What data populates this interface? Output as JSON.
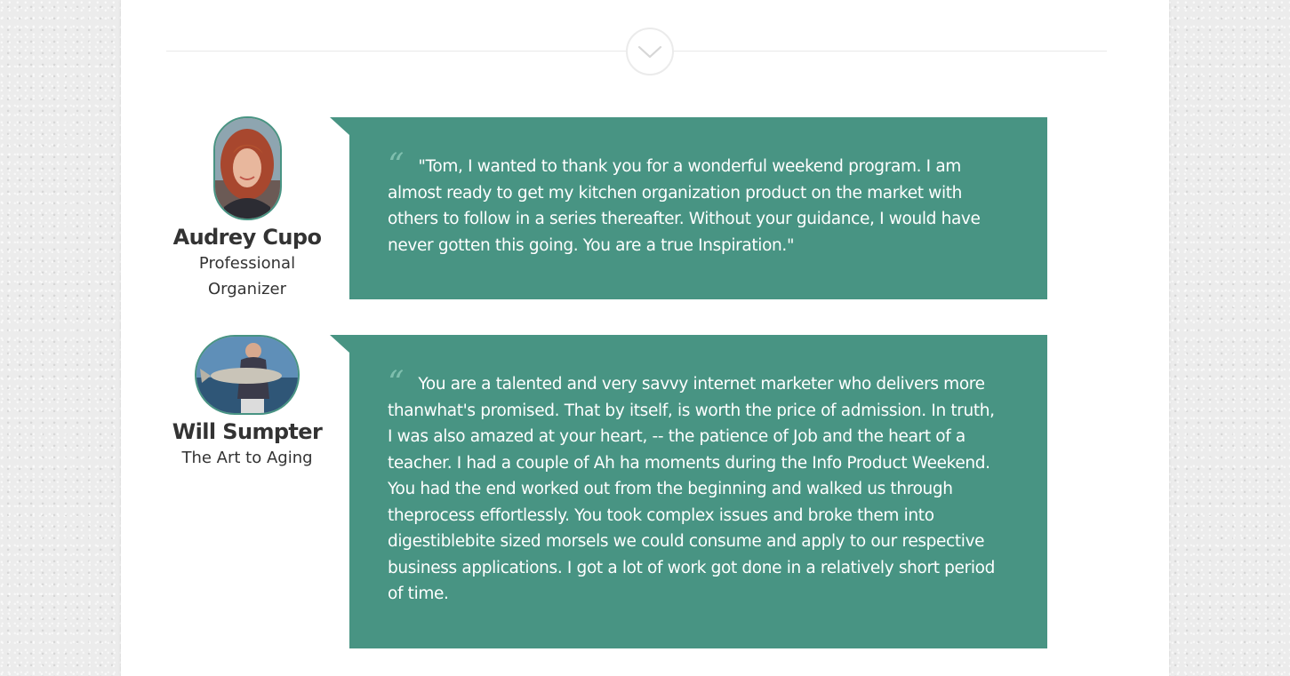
{
  "colors": {
    "accent": "#489483",
    "quote_mark": "#7fbfae",
    "background": "#ececec"
  },
  "divider": {
    "icon": "chevron-down-icon"
  },
  "testimonials": [
    {
      "name": "Audrey Cupo",
      "role": "Professional Organizer",
      "quote_mark": "“",
      "quote": "\"Tom, I wanted to thank you for a wonderful weekend program.  I am almost ready to get my kitchen organization product on the market with others to follow in a series thereafter. Without your guidance, I would have never gotten this going. You are a true Inspiration.\""
    },
    {
      "name": "Will Sumpter",
      "role": "The Art to Aging",
      "quote_mark": "“",
      "quote": "You are a talented and very savvy internet marketer who delivers more thanwhat's promised. That by itself, is worth the price of admission. In truth, I was also amazed at your heart, -- the patience of Job and the heart of a teacher. I had a couple of Ah ha moments during the Info Product Weekend. You had the end worked out from the beginning and walked us through theprocess effortlessly. You took complex issues and broke them into digestiblebite sized morsels we could consume and apply to our respective business applications. I got a lot of work got done in a relatively short period of time."
    }
  ]
}
